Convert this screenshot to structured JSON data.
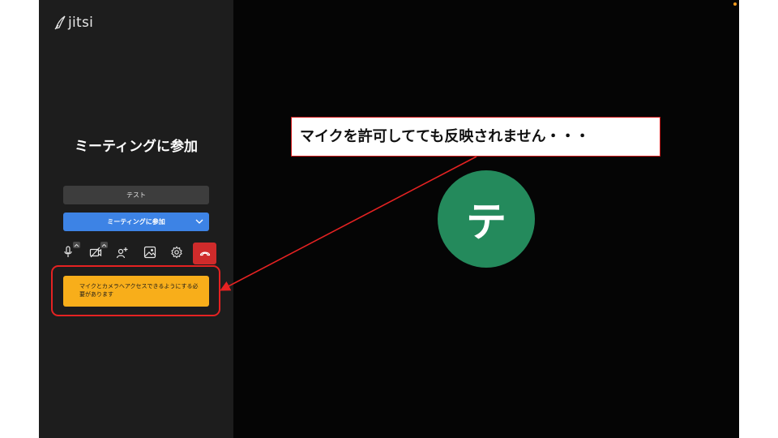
{
  "app": {
    "logo_text": "jitsi"
  },
  "prejoin": {
    "title": "ミーティングに参加",
    "name_value": "テスト",
    "join_label": "ミーティングに参加",
    "permission_warning": "マイクとカメラへアクセスできるようにする必要があります"
  },
  "toolbar": {
    "icons": [
      "microphone-icon",
      "camera-off-icon",
      "invite-people-icon",
      "background-icon",
      "settings-icon",
      "hangup-icon"
    ]
  },
  "participant": {
    "avatar_initial": "テ",
    "avatar_color": "#248a5c"
  },
  "annotation": {
    "callout_text": "マイクを許可してても反映されません・・・",
    "color": "#e52222"
  },
  "colors": {
    "join_blue": "#3d83e5",
    "warning_yellow": "#f8ae1a",
    "hangup_red": "#cf2b2b"
  }
}
